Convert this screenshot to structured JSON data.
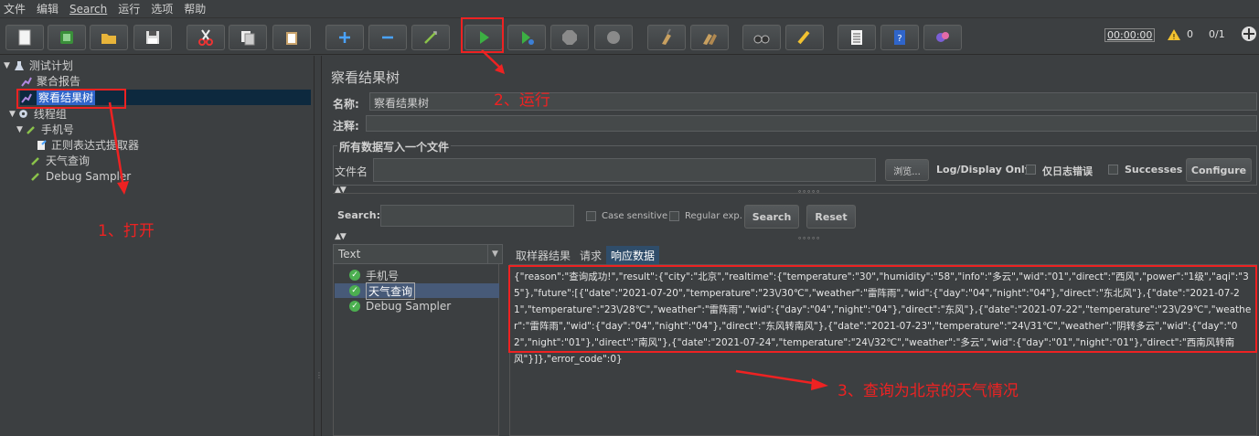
{
  "menu": [
    "文件",
    "编辑",
    "Search",
    "运行",
    "选项",
    "帮助"
  ],
  "toolbar": {
    "timer": "00:00:00",
    "warning_count": "0",
    "threads": "0/1"
  },
  "tree": {
    "items": [
      {
        "label": "测试计划"
      },
      {
        "label": "聚合报告"
      },
      {
        "label": "察看结果树"
      },
      {
        "label": "线程组"
      },
      {
        "label": "手机号"
      },
      {
        "label": "正则表达式提取器"
      },
      {
        "label": "天气查询"
      },
      {
        "label": "Debug Sampler"
      }
    ]
  },
  "panel": {
    "title": "察看结果树",
    "name_label": "名称:",
    "name_value": "察看结果树",
    "comment_label": "注释:",
    "group_title": "所有数据写入一个文件",
    "file_label": "文件名",
    "browse": "浏览...",
    "log_display": "Log/Display Only:",
    "errors_only": "仅日志错误",
    "successes": "Successes",
    "configure": "Configure"
  },
  "search": {
    "label": "Search:",
    "case_sensitive": "Case sensitive",
    "regular_exp": "Regular exp.",
    "search_btn": "Search",
    "reset_btn": "Reset"
  },
  "results": {
    "renderer": "Text",
    "items": [
      {
        "label": "手机号"
      },
      {
        "label": "天气查询"
      },
      {
        "label": "Debug Sampler"
      }
    ],
    "tabs": [
      "取样器结果",
      "请求",
      "响应数据"
    ],
    "response_text": "{\"reason\":\"查询成功!\",\"result\":{\"city\":\"北京\",\"realtime\":{\"temperature\":\"30\",\"humidity\":\"58\",\"info\":\"多云\",\"wid\":\"01\",\"direct\":\"西风\",\"power\":\"1级\",\"aqi\":\"35\"},\"future\":[{\"date\":\"2021-07-20\",\"temperature\":\"23\\/30℃\",\"weather\":\"雷阵雨\",\"wid\":{\"day\":\"04\",\"night\":\"04\"},\"direct\":\"东北风\"},{\"date\":\"2021-07-21\",\"temperature\":\"23\\/28℃\",\"weather\":\"雷阵雨\",\"wid\":{\"day\":\"04\",\"night\":\"04\"},\"direct\":\"东风\"},{\"date\":\"2021-07-22\",\"temperature\":\"23\\/29℃\",\"weather\":\"雷阵雨\",\"wid\":{\"day\":\"04\",\"night\":\"04\"},\"direct\":\"东风转南风\"},{\"date\":\"2021-07-23\",\"temperature\":\"24\\/31℃\",\"weather\":\"阴转多云\",\"wid\":{\"day\":\"02\",\"night\":\"01\"},\"direct\":\"南风\"},{\"date\":\"2021-07-24\",\"temperature\":\"24\\/32℃\",\"weather\":\"多云\",\"wid\":{\"day\":\"01\",\"night\":\"01\"},\"direct\":\"西南风转南风\"}]},\"error_code\":0}"
  },
  "annotations": {
    "step1": "1、打开",
    "step2": "2、运行",
    "step3": "3、查询为北京的天气情况"
  },
  "colors": {
    "annotation_red": "#ee2222",
    "selection_blue": "#2f65ca",
    "run_green": "#3cb043"
  }
}
